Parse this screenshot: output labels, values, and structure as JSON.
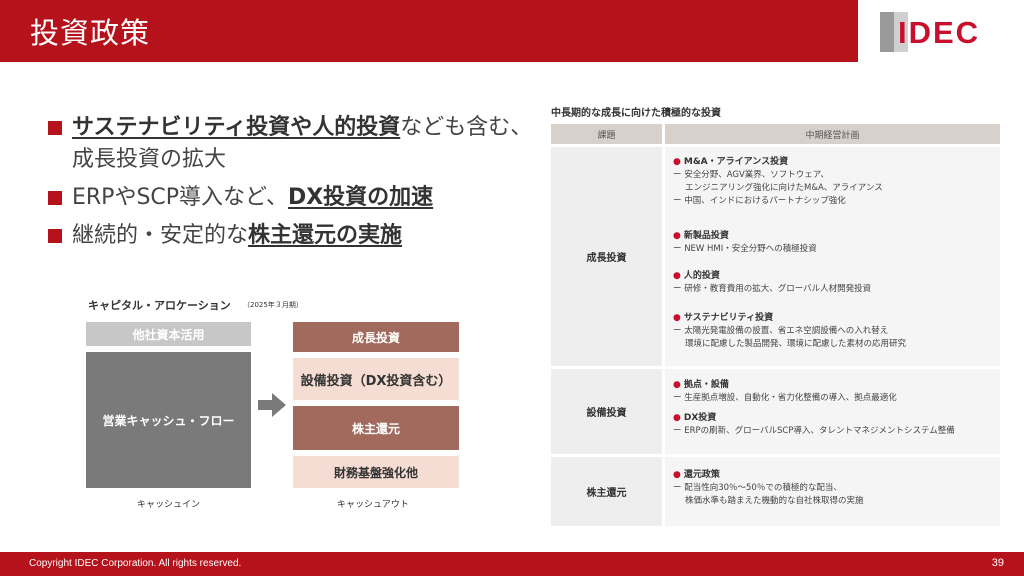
{
  "header": {
    "title": "投資政策",
    "logo_text": "IDEC"
  },
  "bullets": [
    {
      "pre": "",
      "bold": "サステナビリティ投資や人的投資",
      "post": "なども含む、成長投資の拡大"
    },
    {
      "pre": "ERPやSCP導入など、",
      "bold": "DX投資の加速",
      "post": ""
    },
    {
      "pre": "継続的・安定的な",
      "bold": "株主還元の実施",
      "post": ""
    }
  ],
  "capital": {
    "title": "キャピタル・アロケーション",
    "note": "（2025年３月期）",
    "in_top": "他社資本活用",
    "in_main": "営業キャッシュ・フロー",
    "outs": [
      "成長投資",
      "設備投資（DX投資含む）",
      "株主還元",
      "財務基盤強化他"
    ],
    "label_in": "キャッシュイン",
    "label_out": "キャッシュアウト"
  },
  "table": {
    "title": "中長期的な成長に向けた積極的な投資",
    "col_issue": "課題",
    "col_plan": "中期経営計画",
    "rows": [
      {
        "category": "成長投資",
        "blocks": [
          {
            "heading": "M&A・アライアンス投資",
            "lines": [
              "安全分野、AGV業界、ソフトウェア、",
              "エンジニアリング強化に向けたM&A、アライアンス",
              "中国、インドにおけるパートナシップ強化"
            ]
          },
          {
            "heading": "新製品投資",
            "lines": [
              "NEW HMI・安全分野への積極投資"
            ]
          },
          {
            "heading": "人的投資",
            "lines": [
              "研修・教育費用の拡大、グローバル人材開発投資"
            ]
          },
          {
            "heading": "サステナビリティ投資",
            "lines": [
              "太陽光発電設備の設置、省エネ空調設備への入れ替え",
              "環境に配慮した製品開発、環境に配慮した素材の応用研究"
            ]
          }
        ]
      },
      {
        "category": "設備投資",
        "blocks": [
          {
            "heading": "拠点・設備",
            "lines": [
              "生産拠点増設、自動化・省力化整備の導入、拠点最適化"
            ]
          },
          {
            "heading": "DX投資",
            "lines": [
              "ERPの刷新、グローバルSCP導入、タレントマネジメントシステム整備"
            ]
          }
        ]
      },
      {
        "category": "株主還元",
        "blocks": [
          {
            "heading": "還元政策",
            "lines": [
              "配当性向30％～50％での積極的な配当、",
              "株価水準も踏まえた機動的な自社株取得の実施"
            ]
          }
        ]
      }
    ]
  },
  "footer": {
    "copyright": "Copyright IDEC Corporation. All rights reserved.",
    "page": "39"
  },
  "colors": {
    "brand_red": "#b5121b",
    "accent_brown": "#a16a5c",
    "accent_pink": "#f5ddd3",
    "gray": "#7a7a7a"
  }
}
